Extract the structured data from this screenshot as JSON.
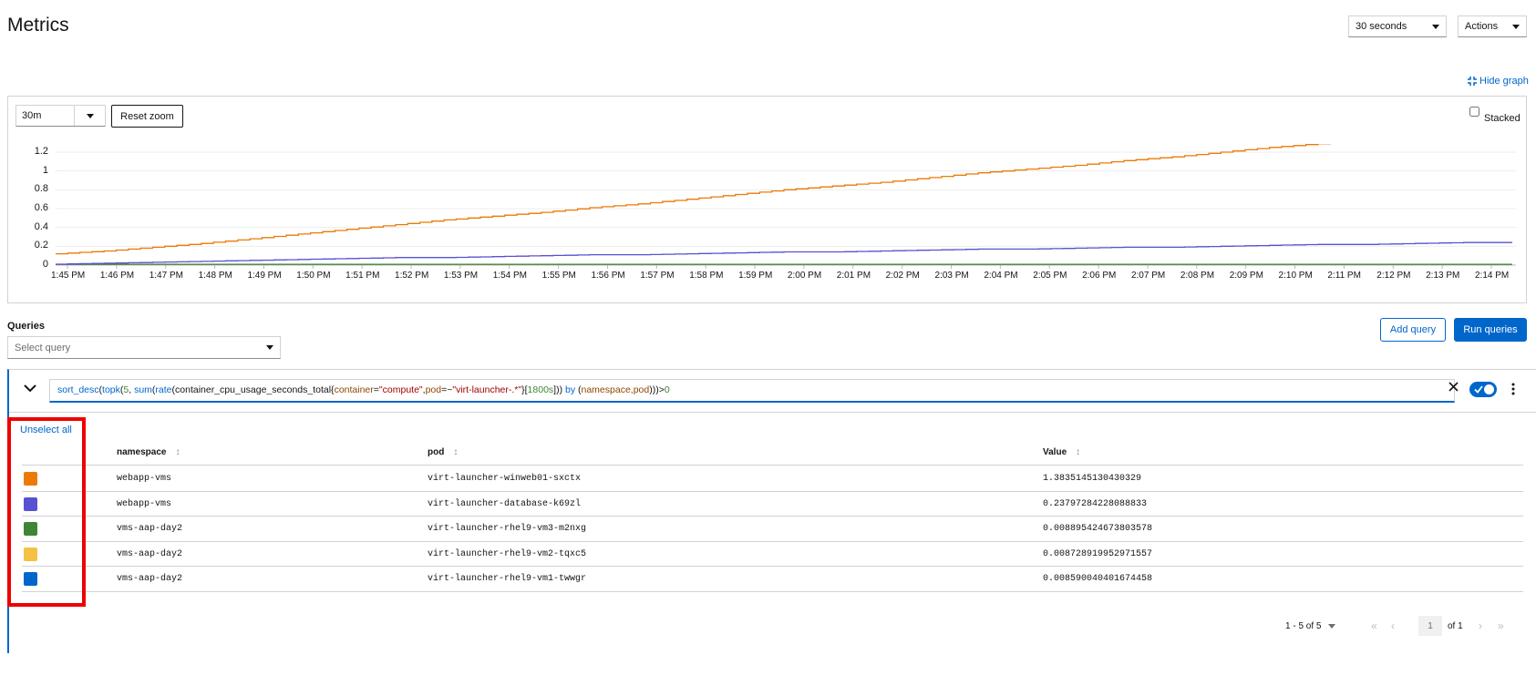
{
  "page": {
    "title": "Metrics"
  },
  "toolbar": {
    "refresh_interval": "30 seconds",
    "actions_label": "Actions"
  },
  "graph": {
    "hide_label": "Hide graph",
    "range": "30m",
    "reset_zoom_label": "Reset zoom",
    "stacked_label": "Stacked",
    "stacked_checked": false
  },
  "chart_data": {
    "type": "line",
    "ylim": [
      0,
      1.3
    ],
    "yticks": [
      "1.2",
      "1",
      "0.8",
      "0.6",
      "0.4",
      "0.2",
      "0"
    ],
    "ytick_values": [
      1.2,
      1,
      0.8,
      0.6,
      0.4,
      0.2,
      0
    ],
    "xticks": [
      "1:45 PM",
      "1:46 PM",
      "1:47 PM",
      "1:48 PM",
      "1:49 PM",
      "1:50 PM",
      "1:51 PM",
      "1:52 PM",
      "1:53 PM",
      "1:54 PM",
      "1:55 PM",
      "1:56 PM",
      "1:57 PM",
      "1:58 PM",
      "1:59 PM",
      "2:00 PM",
      "2:01 PM",
      "2:02 PM",
      "2:03 PM",
      "2:04 PM",
      "2:05 PM",
      "2:06 PM",
      "2:07 PM",
      "2:08 PM",
      "2:09 PM",
      "2:10 PM",
      "2:11 PM",
      "2:12 PM",
      "2:13 PM",
      "2:14 PM"
    ],
    "grid": true,
    "series": [
      {
        "color": "#ec7a08",
        "values": [
          0.12,
          0.15,
          0.19,
          0.23,
          0.28,
          0.33,
          0.38,
          0.43,
          0.48,
          0.52,
          0.56,
          0.61,
          0.65,
          0.7,
          0.75,
          0.8,
          0.84,
          0.88,
          0.93,
          0.98,
          1.02,
          1.06,
          1.11,
          1.15,
          1.2,
          1.25,
          1.29,
          1.33,
          1.36,
          1.38,
          1.38
        ]
      },
      {
        "color": "#5752d1",
        "values": [
          0.01,
          0.02,
          0.03,
          0.04,
          0.05,
          0.06,
          0.07,
          0.08,
          0.08,
          0.09,
          0.1,
          0.11,
          0.11,
          0.12,
          0.13,
          0.14,
          0.14,
          0.15,
          0.16,
          0.17,
          0.17,
          0.18,
          0.19,
          0.19,
          0.2,
          0.21,
          0.22,
          0.22,
          0.23,
          0.24,
          0.24
        ]
      },
      {
        "color": "#3e8635",
        "values": [
          0.009,
          0.009,
          0.009,
          0.009,
          0.009,
          0.009,
          0.009,
          0.009,
          0.009,
          0.009,
          0.009,
          0.009,
          0.009,
          0.009,
          0.009,
          0.009,
          0.009,
          0.009,
          0.009,
          0.009,
          0.009,
          0.009,
          0.009,
          0.009,
          0.009,
          0.009,
          0.009,
          0.009,
          0.009,
          0.009,
          0.009
        ]
      },
      {
        "color": "#f4c145",
        "values": [
          0.0087,
          0.0087,
          0.0087,
          0.0087,
          0.0087,
          0.0087,
          0.0087,
          0.0087,
          0.0087,
          0.0087,
          0.0087,
          0.0087,
          0.0087,
          0.0087,
          0.0087,
          0.0087,
          0.0087,
          0.0087,
          0.0087,
          0.0087,
          0.0087,
          0.0087,
          0.0087,
          0.0087,
          0.0087,
          0.0087,
          0.0087,
          0.0087,
          0.0087,
          0.0087,
          0.0087
        ]
      },
      {
        "color": "#0066cc",
        "values": [
          0.0086,
          0.0086,
          0.0086,
          0.0086,
          0.0086,
          0.0086,
          0.0086,
          0.0086,
          0.0086,
          0.0086,
          0.0086,
          0.0086,
          0.0086,
          0.0086,
          0.0086,
          0.0086,
          0.0086,
          0.0086,
          0.0086,
          0.0086,
          0.0086,
          0.0086,
          0.0086,
          0.0086,
          0.0086,
          0.0086,
          0.0086,
          0.0086,
          0.0086,
          0.0086,
          0.0086
        ]
      }
    ]
  },
  "queries": {
    "label": "Queries",
    "select_placeholder": "Select query",
    "add_label": "Add query",
    "run_label": "Run queries",
    "expression": {
      "p1": "sort_desc",
      "p2": "(",
      "p3": "topk",
      "p4": "(",
      "p5": "5",
      "p6": ", ",
      "p7": "sum",
      "p8": "(",
      "p9": "rate",
      "p10": "(container_cpu_usage_seconds_total{",
      "p11": "container",
      "p12": "=",
      "p13": "\"compute\"",
      "p14": ",",
      "p15": "pod",
      "p16": "=~",
      "p17": "\"virt-launcher-.*\"",
      "p18": "}[",
      "p19": "1800s",
      "p20": "])) ",
      "p21": "by",
      "p22": " (",
      "p23": "namespace,pod",
      "p24": ")))>",
      "p25": "0"
    },
    "enabled": true
  },
  "results": {
    "unselect_all_label": "Unselect all",
    "columns": [
      "namespace",
      "pod",
      "Value"
    ],
    "rows": [
      {
        "color": "#ec7a08",
        "namespace": "webapp-vms",
        "pod": "virt-launcher-winweb01-sxctx",
        "value": "1.3835145130430329"
      },
      {
        "color": "#5752d1",
        "namespace": "webapp-vms",
        "pod": "virt-launcher-database-k69zl",
        "value": "0.23797284228088833"
      },
      {
        "color": "#3e8635",
        "namespace": "vms-aap-day2",
        "pod": "virt-launcher-rhel9-vm3-m2nxg",
        "value": "0.008895424673803578"
      },
      {
        "color": "#f4c145",
        "namespace": "vms-aap-day2",
        "pod": "virt-launcher-rhel9-vm2-tqxc5",
        "value": "0.008728919952971557"
      },
      {
        "color": "#0066cc",
        "namespace": "vms-aap-day2",
        "pod": "virt-launcher-rhel9-vm1-twwgr",
        "value": "0.008590040401674458"
      }
    ]
  },
  "pagination": {
    "range": "1 - 5 of 5",
    "page": "1",
    "of_label": "of 1"
  },
  "icons": {
    "hide_graph": "compress-icon",
    "clear": "close-icon",
    "kebab": "kebab-icon",
    "expand": "chevron-down-icon"
  }
}
